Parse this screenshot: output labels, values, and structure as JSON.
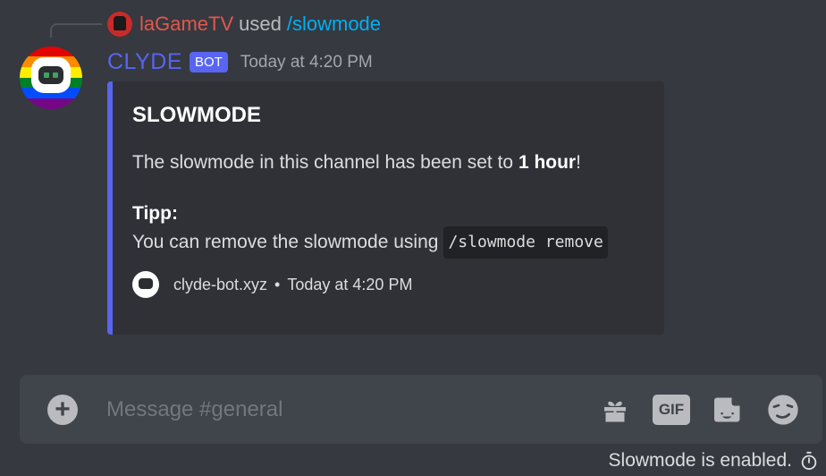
{
  "reply": {
    "user": "laGameTV",
    "used_text": "used",
    "command": "/slowmode"
  },
  "message": {
    "author": "CLYDE",
    "bot_tag": "BOT",
    "timestamp": "Today at 4:20 PM"
  },
  "embed": {
    "accent_color": "#5865f2",
    "title": "SLOWMODE",
    "desc_prefix": "The slowmode in this channel has been set to ",
    "desc_bold": "1 hour",
    "desc_suffix": "!",
    "tip_title": "Tipp:",
    "tip_text": "You can remove the slowmode using",
    "tip_code": "/slowmode remove",
    "footer_site": "clyde-bot.xyz",
    "footer_sep": "•",
    "footer_time": "Today at 4:20 PM"
  },
  "composer": {
    "placeholder": "Message #general",
    "gif_label": "GIF"
  },
  "status": {
    "slowmode_text": "Slowmode is enabled."
  },
  "icons": [
    "add-icon",
    "gift-icon",
    "gif-icon",
    "sticker-icon",
    "emoji-icon",
    "stopwatch-icon"
  ]
}
